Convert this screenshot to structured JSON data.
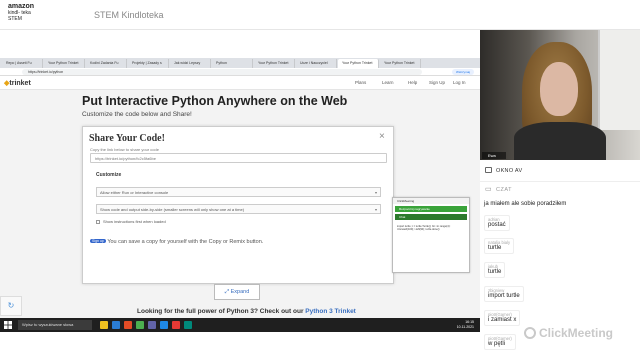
{
  "header": {
    "logo_line1": "amazon",
    "logo_line2": "kindl- teka",
    "logo_line3": "STEM",
    "title": "STEM Kindloteka"
  },
  "browser": {
    "tabs": [
      "Repo | Asseti Fu",
      "Your Python Trinket",
      "Kodini Zadania Fu",
      "Projekty | Zasady s",
      "Jak widzi Lepszy",
      "Python",
      "Your Python Trinket",
      "Ucze i Nauczyciel",
      "Your Python Trinket",
      "Your Python Trinket"
    ],
    "address": "https://trinket.io/python",
    "profile_btn": "Wstrzymaj"
  },
  "trinket": {
    "logo": "trinket",
    "nav": [
      "Plans",
      "Learn",
      "Help",
      "Sign Up",
      "Log In"
    ],
    "headline": "Put Interactive Python Anywhere on the Web",
    "subline": "Customize the code below and  Share!",
    "modal": {
      "title": "Share Your Code!",
      "close": "×",
      "copy_label": "Copy the link below to share your code",
      "link_value": "https://trinket.io/python/fc2c5fa6be",
      "customize": "Customize",
      "select1": "Allow either Run or Interactive console",
      "select2": "Show code and output side-by-side (smaller screens will only show one at a time)",
      "checkbox_label": "Show instructions first when loaded",
      "save_badge": "Sign up",
      "save_text": "You can save a copy for yourself with the  Copy or  Remix button."
    },
    "expand": "Expand",
    "bottom_text": "Looking for the full power of Python 3? Check out our ",
    "bottom_link": "Python 3 Trinket"
  },
  "cm_panel": {
    "head": "ClickMeeting",
    "bar1": "Rozpocznij nagrywanie",
    "bar2": "Chat",
    "body": "import turtle; t = turtle.Turtle(); for i in range(4): t.forward(100); t.left(90); turtle.done()"
  },
  "taskbar": {
    "search": "Wpisz tu wyszukiwane słowa",
    "time": "16:15",
    "date": "10.11.2021"
  },
  "camera": {
    "label": "Ewa"
  },
  "okno": {
    "label": "OKNO AV"
  },
  "chat": {
    "title": "CZAT",
    "messages": [
      {
        "who": "",
        "text": "ja miałem ale sobie poradziłem"
      },
      {
        "who": "adrian",
        "text": "postać"
      },
      {
        "who": "natalia bialy",
        "text": "turtle"
      },
      {
        "who": "jakub",
        "text": "turtle"
      },
      {
        "who": "zbigniew",
        "text": "import turtle"
      },
      {
        "who": "piotr(Gamer)",
        "text": "i zamiast x"
      },
      {
        "who": "piotr(Gamer)",
        "text": "w pętli"
      }
    ]
  },
  "branding": {
    "name": "ClickMeeting"
  }
}
